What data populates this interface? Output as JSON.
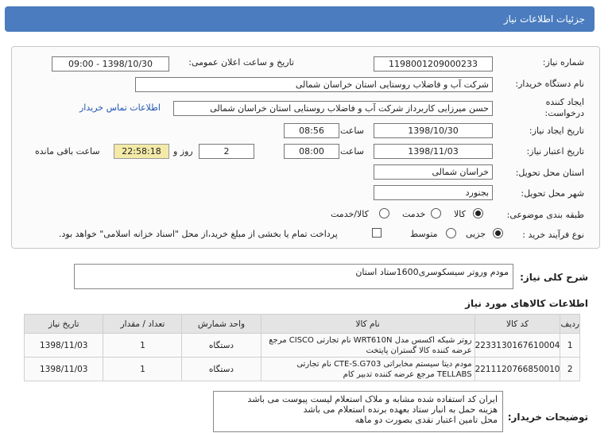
{
  "title": "جزئیات اطلاعات نیاز",
  "form": {
    "need_number": {
      "label": "شماره نیاز:",
      "value": "1198001209000233"
    },
    "announce": {
      "label": "تاریخ و ساعت اعلان عمومی:",
      "value": "1398/10/30 - 09:00"
    },
    "buyer": {
      "label": "نام دستگاه خریدار:",
      "value": "شرکت آب و فاضلاب روستایی استان خراسان شمالی"
    },
    "creator": {
      "label": "ایجاد کننده درخواست:",
      "value": "حسن  میرزایی کاربرداز شرکت آب و فاضلاب روستایی استان خراسان شمالی",
      "contact_link": "اطلاعات تماس خریدار"
    },
    "created": {
      "label": "تاریخ ایجاد نیاز:",
      "date": "1398/10/30",
      "time_label": "ساعت",
      "time": "08:56"
    },
    "validity": {
      "label": "تاریخ اعتبار نیاز:",
      "date": "1398/11/03",
      "time_label": "ساعت",
      "time": "08:00",
      "days": "2",
      "days_label": "روز و",
      "remaining": "22:58:18",
      "remaining_label": "ساعت باقی مانده"
    },
    "province": {
      "label": "استان محل تحویل:",
      "value": "خراسان شمالی"
    },
    "city": {
      "label": "شهر محل تحویل:",
      "value": "بجنورد"
    },
    "category": {
      "label": "طبقه بندی موضوعی:",
      "options": [
        "کالا",
        "خدمت",
        "کالا/خدمت"
      ],
      "selected": "کالا"
    },
    "process": {
      "label": "نوع فرآیند خرید :",
      "options": [
        "جزیی",
        "متوسط"
      ],
      "selected": "جزیی",
      "payment_note": "پرداخت تمام یا بخشی از مبلغ خرید،از محل \"اسناد خزانه اسلامی\" خواهد بود."
    }
  },
  "general_desc": {
    "label": "شرح کلی نیاز:",
    "value": "مودم وروتر سیسکوسری1600ستاد استان"
  },
  "items_header": "اطلاعات کالاهای مورد نیاز",
  "table": {
    "headers": [
      "ردیف",
      "کد کالا",
      "نام کالا",
      "واحد شمارش",
      "تعداد / مقدار",
      "تاریخ نیاز"
    ],
    "rows": [
      {
        "row": "1",
        "code": "2233130167610004",
        "name": "روتر شبکه اکسس مدل WRT610N نام تجارتی CISCO مرجع عرضه کننده کالا گستران پایتخت",
        "unit": "دستگاه",
        "qty": "1",
        "date": "1398/11/03"
      },
      {
        "row": "2",
        "code": "2211120766850010",
        "name": "مودم دیتا سیستم مخابراتی CTE-S.G703 نام تجارتی TELLABS مرجع عرضه کننده تدبیر کام",
        "unit": "دستگاه",
        "qty": "1",
        "date": "1398/11/03"
      }
    ]
  },
  "buyer_notes": {
    "label": "توضیحات خریدار:",
    "lines": [
      "ایران کد استفاده شده مشابه و ملاک استعلام لیست پیوست می باشد",
      "هزینه حمل  به انبار ستاد بعهده برنده استعلام می باشد",
      "محل تامین اعتبار نقدی بصورت دو ماهه"
    ]
  }
}
